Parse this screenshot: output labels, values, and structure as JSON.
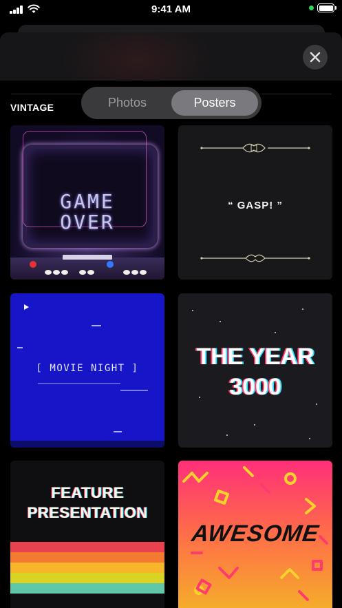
{
  "status_bar": {
    "time": "9:41 AM"
  },
  "header": {
    "close_icon": "xmark-icon"
  },
  "segmented_control": {
    "options": [
      "Photos",
      "Posters"
    ],
    "selected": "Posters"
  },
  "section": {
    "title": "VINTAGE"
  },
  "posters": [
    {
      "id": "game-over",
      "lines": [
        "GAME",
        "OVER"
      ]
    },
    {
      "id": "gasp",
      "text": "“ GASP! ”"
    },
    {
      "id": "movie-night",
      "text": "[ MOVIE NIGHT ]"
    },
    {
      "id": "the-year-3000",
      "lines": [
        "THE YEAR",
        "3000"
      ]
    },
    {
      "id": "feature-presentation",
      "lines": [
        "FEATURE",
        "PRESENTATION"
      ]
    },
    {
      "id": "awesome",
      "text": "AWESOME"
    }
  ],
  "colors": {
    "selected_segment": "#7a7a7e",
    "segment_bg": "#3a3a3c",
    "movie_night_bg": "#1616c8",
    "stripes": [
      "#e8424f",
      "#f47a32",
      "#f7b52a",
      "#d9d323",
      "#5fc8a8"
    ]
  }
}
